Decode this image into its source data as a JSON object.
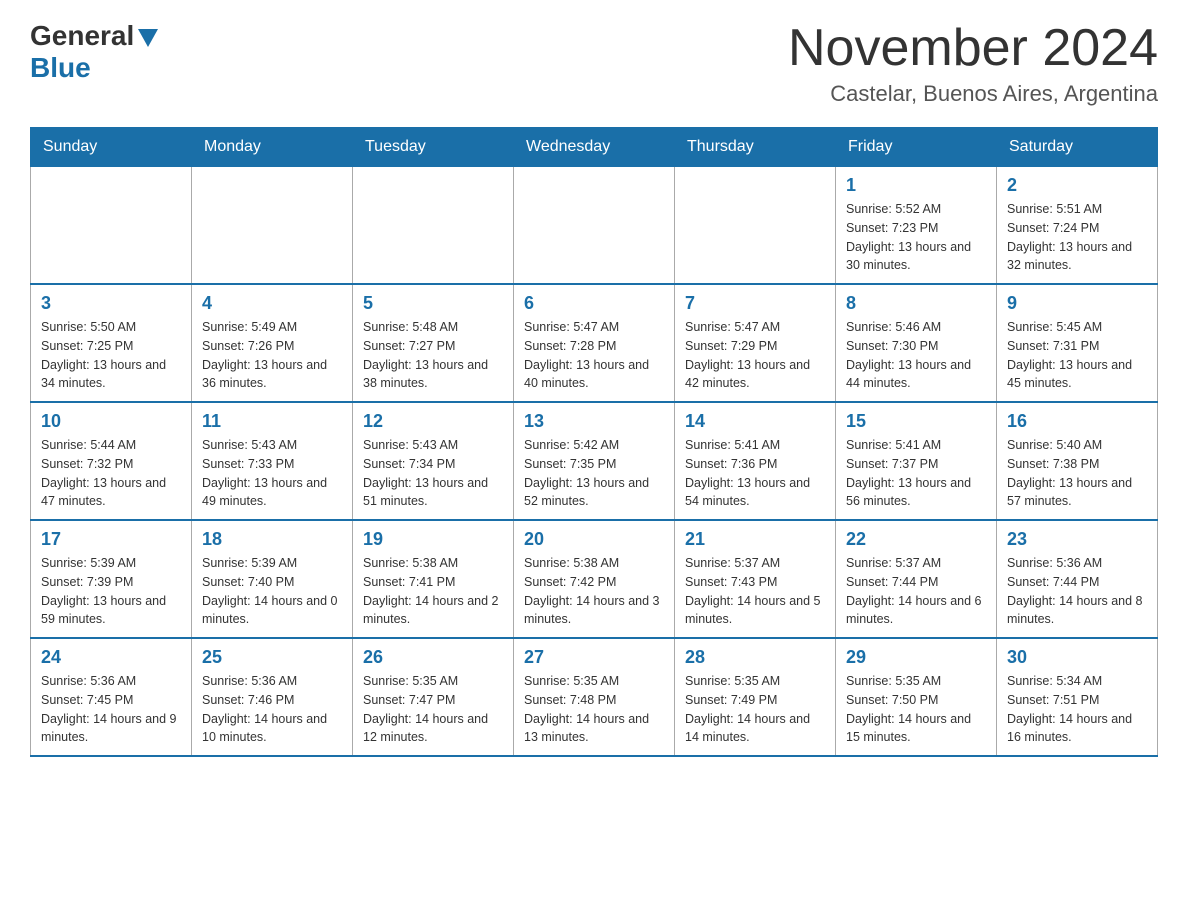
{
  "header": {
    "logo_general": "General",
    "logo_blue": "Blue",
    "month_title": "November 2024",
    "location": "Castelar, Buenos Aires, Argentina"
  },
  "weekdays": [
    "Sunday",
    "Monday",
    "Tuesday",
    "Wednesday",
    "Thursday",
    "Friday",
    "Saturday"
  ],
  "weeks": [
    [
      {
        "day": "",
        "info": ""
      },
      {
        "day": "",
        "info": ""
      },
      {
        "day": "",
        "info": ""
      },
      {
        "day": "",
        "info": ""
      },
      {
        "day": "",
        "info": ""
      },
      {
        "day": "1",
        "info": "Sunrise: 5:52 AM\nSunset: 7:23 PM\nDaylight: 13 hours and 30 minutes."
      },
      {
        "day": "2",
        "info": "Sunrise: 5:51 AM\nSunset: 7:24 PM\nDaylight: 13 hours and 32 minutes."
      }
    ],
    [
      {
        "day": "3",
        "info": "Sunrise: 5:50 AM\nSunset: 7:25 PM\nDaylight: 13 hours and 34 minutes."
      },
      {
        "day": "4",
        "info": "Sunrise: 5:49 AM\nSunset: 7:26 PM\nDaylight: 13 hours and 36 minutes."
      },
      {
        "day": "5",
        "info": "Sunrise: 5:48 AM\nSunset: 7:27 PM\nDaylight: 13 hours and 38 minutes."
      },
      {
        "day": "6",
        "info": "Sunrise: 5:47 AM\nSunset: 7:28 PM\nDaylight: 13 hours and 40 minutes."
      },
      {
        "day": "7",
        "info": "Sunrise: 5:47 AM\nSunset: 7:29 PM\nDaylight: 13 hours and 42 minutes."
      },
      {
        "day": "8",
        "info": "Sunrise: 5:46 AM\nSunset: 7:30 PM\nDaylight: 13 hours and 44 minutes."
      },
      {
        "day": "9",
        "info": "Sunrise: 5:45 AM\nSunset: 7:31 PM\nDaylight: 13 hours and 45 minutes."
      }
    ],
    [
      {
        "day": "10",
        "info": "Sunrise: 5:44 AM\nSunset: 7:32 PM\nDaylight: 13 hours and 47 minutes."
      },
      {
        "day": "11",
        "info": "Sunrise: 5:43 AM\nSunset: 7:33 PM\nDaylight: 13 hours and 49 minutes."
      },
      {
        "day": "12",
        "info": "Sunrise: 5:43 AM\nSunset: 7:34 PM\nDaylight: 13 hours and 51 minutes."
      },
      {
        "day": "13",
        "info": "Sunrise: 5:42 AM\nSunset: 7:35 PM\nDaylight: 13 hours and 52 minutes."
      },
      {
        "day": "14",
        "info": "Sunrise: 5:41 AM\nSunset: 7:36 PM\nDaylight: 13 hours and 54 minutes."
      },
      {
        "day": "15",
        "info": "Sunrise: 5:41 AM\nSunset: 7:37 PM\nDaylight: 13 hours and 56 minutes."
      },
      {
        "day": "16",
        "info": "Sunrise: 5:40 AM\nSunset: 7:38 PM\nDaylight: 13 hours and 57 minutes."
      }
    ],
    [
      {
        "day": "17",
        "info": "Sunrise: 5:39 AM\nSunset: 7:39 PM\nDaylight: 13 hours and 59 minutes."
      },
      {
        "day": "18",
        "info": "Sunrise: 5:39 AM\nSunset: 7:40 PM\nDaylight: 14 hours and 0 minutes."
      },
      {
        "day": "19",
        "info": "Sunrise: 5:38 AM\nSunset: 7:41 PM\nDaylight: 14 hours and 2 minutes."
      },
      {
        "day": "20",
        "info": "Sunrise: 5:38 AM\nSunset: 7:42 PM\nDaylight: 14 hours and 3 minutes."
      },
      {
        "day": "21",
        "info": "Sunrise: 5:37 AM\nSunset: 7:43 PM\nDaylight: 14 hours and 5 minutes."
      },
      {
        "day": "22",
        "info": "Sunrise: 5:37 AM\nSunset: 7:44 PM\nDaylight: 14 hours and 6 minutes."
      },
      {
        "day": "23",
        "info": "Sunrise: 5:36 AM\nSunset: 7:44 PM\nDaylight: 14 hours and 8 minutes."
      }
    ],
    [
      {
        "day": "24",
        "info": "Sunrise: 5:36 AM\nSunset: 7:45 PM\nDaylight: 14 hours and 9 minutes."
      },
      {
        "day": "25",
        "info": "Sunrise: 5:36 AM\nSunset: 7:46 PM\nDaylight: 14 hours and 10 minutes."
      },
      {
        "day": "26",
        "info": "Sunrise: 5:35 AM\nSunset: 7:47 PM\nDaylight: 14 hours and 12 minutes."
      },
      {
        "day": "27",
        "info": "Sunrise: 5:35 AM\nSunset: 7:48 PM\nDaylight: 14 hours and 13 minutes."
      },
      {
        "day": "28",
        "info": "Sunrise: 5:35 AM\nSunset: 7:49 PM\nDaylight: 14 hours and 14 minutes."
      },
      {
        "day": "29",
        "info": "Sunrise: 5:35 AM\nSunset: 7:50 PM\nDaylight: 14 hours and 15 minutes."
      },
      {
        "day": "30",
        "info": "Sunrise: 5:34 AM\nSunset: 7:51 PM\nDaylight: 14 hours and 16 minutes."
      }
    ]
  ]
}
